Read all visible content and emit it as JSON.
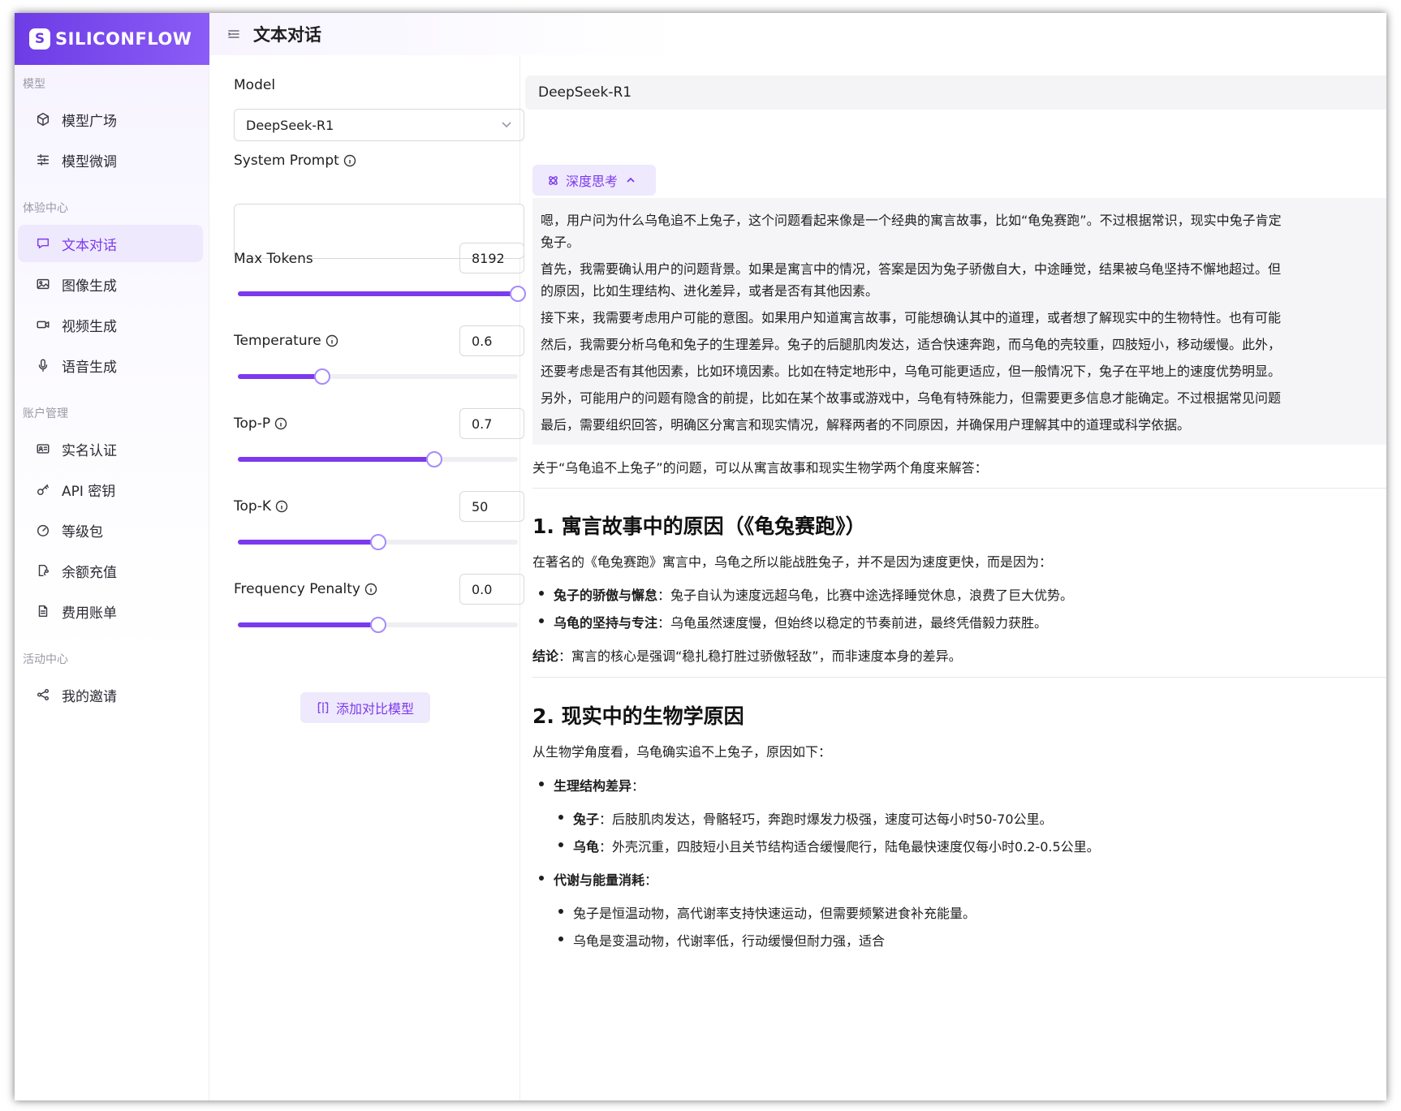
{
  "brand": {
    "logo_text": "SILICONFLOW",
    "accent": "#7c3aed"
  },
  "sidebar": {
    "groups": [
      {
        "title": "模型",
        "items": [
          {
            "label": "模型广场",
            "icon": "cube-icon"
          },
          {
            "label": "模型微调",
            "icon": "sliders-icon"
          }
        ]
      },
      {
        "title": "体验中心",
        "items": [
          {
            "label": "文本对话",
            "icon": "chat-icon",
            "active": true
          },
          {
            "label": "图像生成",
            "icon": "image-icon"
          },
          {
            "label": "视频生成",
            "icon": "video-icon"
          },
          {
            "label": "语音生成",
            "icon": "microphone-icon"
          }
        ]
      },
      {
        "title": "账户管理",
        "items": [
          {
            "label": "实名认证",
            "icon": "id-card-icon"
          },
          {
            "label": "API 密钥",
            "icon": "key-icon"
          },
          {
            "label": "等级包",
            "icon": "gauge-icon"
          },
          {
            "label": "余额充值",
            "icon": "recharge-icon"
          },
          {
            "label": "费用账单",
            "icon": "bill-icon"
          }
        ]
      },
      {
        "title": "活动中心",
        "items": [
          {
            "label": "我的邀请",
            "icon": "share-icon"
          }
        ]
      }
    ]
  },
  "header": {
    "title": "文本对话"
  },
  "settings": {
    "model_label": "Model",
    "model_value": "DeepSeek-R1",
    "system_prompt_label": "System Prompt",
    "system_prompt_value": "",
    "params": [
      {
        "label": "Max Tokens",
        "value": "8192",
        "fill_fraction": 1.0,
        "info": false
      },
      {
        "label": "Temperature",
        "value": "0.6",
        "fill_fraction": 0.3,
        "info": true
      },
      {
        "label": "Top-P",
        "value": "0.7",
        "fill_fraction": 0.7,
        "info": true
      },
      {
        "label": "Top-K",
        "value": "50",
        "fill_fraction": 0.5,
        "info": true
      },
      {
        "label": "Frequency Penalty",
        "value": "0.0",
        "fill_fraction": 0.5,
        "info": true
      }
    ],
    "add_compare_label": "添加对比模型"
  },
  "chat": {
    "model_name": "DeepSeek-R1",
    "think_label": "深度思考",
    "thinking": [
      "嗯，用户问为什么乌龟追不上兔子，这个问题看起来像是一个经典的寓言故事，比如“龟兔赛跑”。不过根据常识，现实中兔子肯定",
      "兔子。",
      "首先，我需要确认用户的问题背景。如果是寓言中的情况，答案是因为兔子骄傲自大，中途睡觉，结果被乌龟坚持不懈地超过。但",
      "的原因，比如生理结构、进化差异，或者是否有其他因素。",
      "接下来，我需要考虑用户可能的意图。如果用户知道寓言故事，可能想确认其中的道理，或者想了解现实中的生物特性。也有可能",
      "然后，我需要分析乌龟和兔子的生理差异。兔子的后腿肌肉发达，适合快速奔跑，而乌龟的壳较重，四肢短小，移动缓慢。此外，",
      "还要考虑是否有其他因素，比如环境因素。比如在特定地形中，乌龟可能更适应，但一般情况下，兔子在平地上的速度优势明显。",
      "另外，可能用户的问题有隐含的前提，比如在某个故事或游戏中，乌龟有特殊能力，但需要更多信息才能确定。不过根据常见问题",
      "最后，需要组织回答，明确区分寓言和现实情况，解释两者的不同原因，并确保用户理解其中的道理或科学依据。"
    ],
    "answer": {
      "intro": "关于“乌龟追不上兔子”的问题，可以从寓言故事和现实生物学两个角度来解答：",
      "h1": "1. 寓言故事中的原因（《龟兔赛跑》）",
      "p1": "在著名的《龟兔赛跑》寓言中，乌龟之所以能战胜兔子，并不是因为速度更快，而是因为：",
      "b1_bold": "兔子的骄傲与懈怠",
      "b1_text": "：兔子自认为速度远超乌龟，比赛中途选择睡觉休息，浪费了巨大优势。",
      "b2_bold": "乌龟的坚持与专注",
      "b2_text": "：乌龟虽然速度慢，但始终以稳定的节奏前进，最终凭借毅力获胜。",
      "conclusion_bold": "结论",
      "conclusion_text": "：寓言的核心是强调“稳扎稳打胜过骄傲轻敌”，而非速度本身的差异。",
      "h2": "2. 现实中的生物学原因",
      "p2": "从生物学角度看，乌龟确实追不上兔子，原因如下：",
      "c1_bold": "生理结构差异",
      "c1_colon": "：",
      "c1a_bold": "兔子",
      "c1a_text": "：后肢肌肉发达，骨骼轻巧，奔跑时爆发力极强，速度可达每小时50-70公里。",
      "c1b_bold": "乌龟",
      "c1b_text": "：外壳沉重，四肢短小且关节结构适合缓慢爬行，陆龟最快速度仅每小时0.2-0.5公里。",
      "c2_bold": "代谢与能量消耗",
      "c2_colon": "：",
      "c2a_text": "兔子是恒温动物，高代谢率支持快速运动，但需要频繁进食补充能量。",
      "c2b_text": "乌龟是变温动物，代谢率低，行动缓慢但耐力强，适合"
    }
  }
}
